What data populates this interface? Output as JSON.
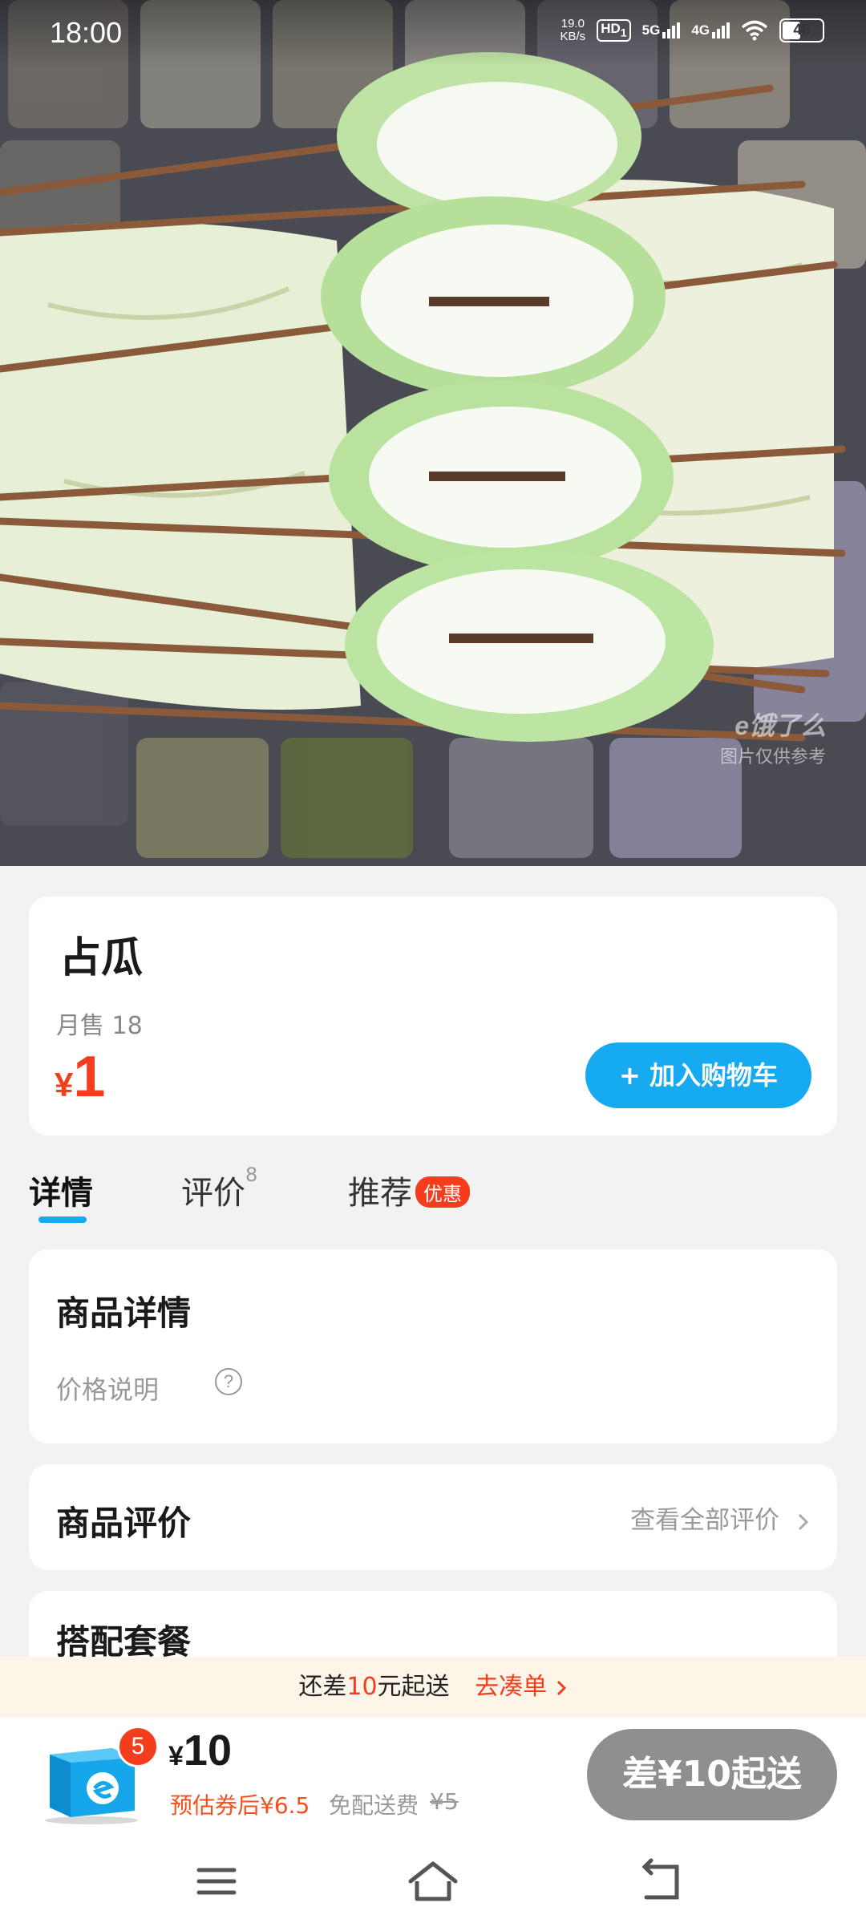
{
  "status_bar": {
    "time": "18:00",
    "net_speed": "19.0",
    "net_speed_unit": "KB/s",
    "hd": "HD",
    "hd_sub": "1",
    "net1": "5G",
    "net2": "4G",
    "battery": "46"
  },
  "hero": {
    "watermark_logo": "e饿了么",
    "watermark_text": "图片仅供参考"
  },
  "product": {
    "name": "占瓜",
    "monthly_sales": "月售 18",
    "currency": "¥",
    "price": "1",
    "add_to_cart": "+ 加入购物车"
  },
  "tabs": [
    {
      "label": "详情",
      "active": true
    },
    {
      "label": "评价",
      "count": "8"
    },
    {
      "label": "推荐",
      "badge": "优惠"
    }
  ],
  "details": {
    "title": "商品详情",
    "price_note": "价格说明",
    "help_glyph": "?"
  },
  "reviews": {
    "title": "商品评价",
    "view_all": "查看全部评价"
  },
  "combo": {
    "title": "搭配套餐"
  },
  "min_order": {
    "prefix": "还差",
    "amount": "10",
    "suffix": "元起送",
    "action": "去凑单"
  },
  "cart": {
    "count": "5",
    "currency": "¥",
    "total": "10",
    "estimated": "预估券后¥6.5",
    "delivery_free": "免配送费",
    "delivery_orig": "¥5",
    "checkout": "差¥10起送"
  },
  "colors": {
    "accent_blue": "#16aaf0",
    "price_red": "#f33d1c",
    "checkout_gray": "#8f8f8f"
  },
  "icons": {
    "help": "question-circle-icon",
    "chevron": "chevron-right-icon",
    "cart": "eleme-box-cart-icon",
    "nav_menu": "menu-icon",
    "nav_home": "home-icon",
    "nav_back": "back-icon"
  }
}
